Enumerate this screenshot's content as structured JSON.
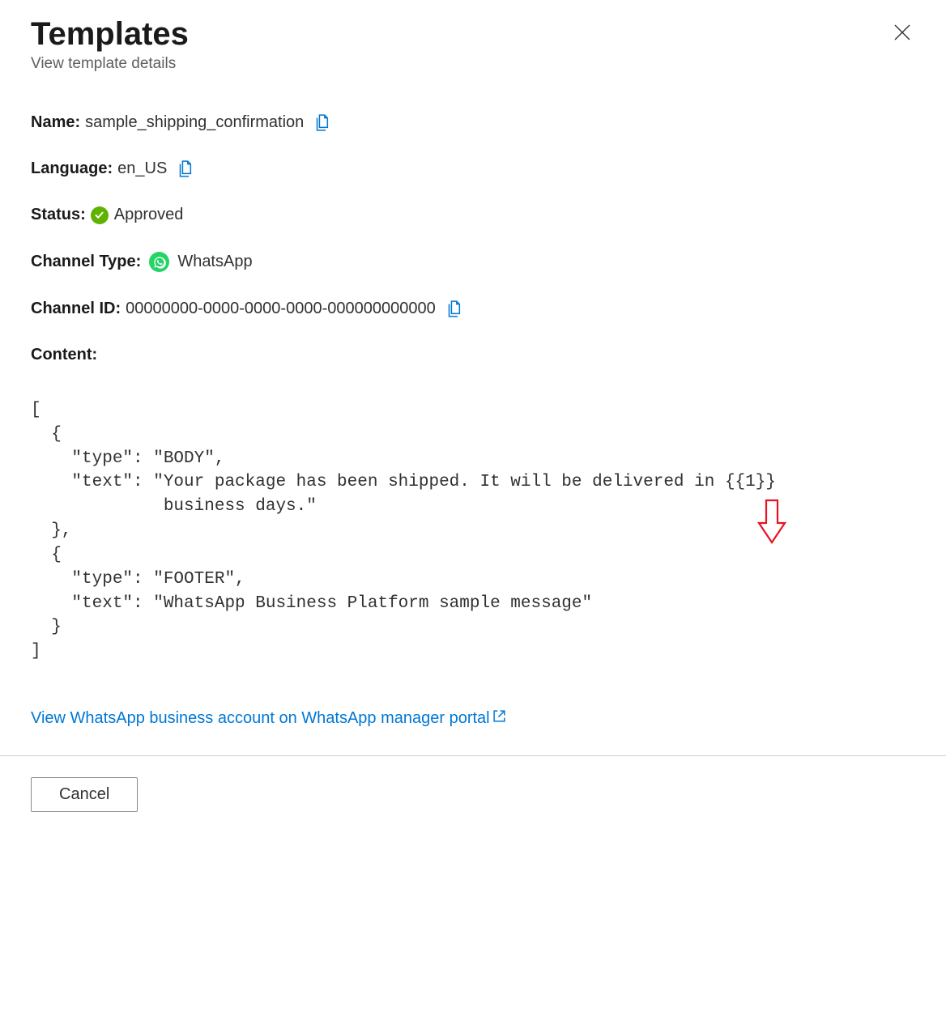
{
  "header": {
    "title": "Templates",
    "subtitle": "View template details"
  },
  "fields": {
    "name_label": "Name:",
    "name_value": "sample_shipping_confirmation",
    "language_label": "Language:",
    "language_value": "en_US",
    "status_label": "Status:",
    "status_value": "Approved",
    "channel_type_label": "Channel Type:",
    "channel_type_value": "WhatsApp",
    "channel_id_label": "Channel ID:",
    "channel_id_value": "00000000-0000-0000-0000-000000000000",
    "content_label": "Content:"
  },
  "content_json": "[\n  {\n    \"type\": \"BODY\",\n    \"text\": \"Your package has been shipped. It will be delivered in {{1}}\n             business days.\"\n  },\n  {\n    \"type\": \"FOOTER\",\n    \"text\": \"WhatsApp Business Platform sample message\"\n  }\n]",
  "link": {
    "portal_text": "View WhatsApp business account on WhatsApp manager portal"
  },
  "footer": {
    "cancel_label": "Cancel"
  },
  "colors": {
    "link_blue": "#0078d4",
    "status_green": "#5fb200",
    "whatsapp_green": "#25d366",
    "annotation_red": "#e81224"
  }
}
